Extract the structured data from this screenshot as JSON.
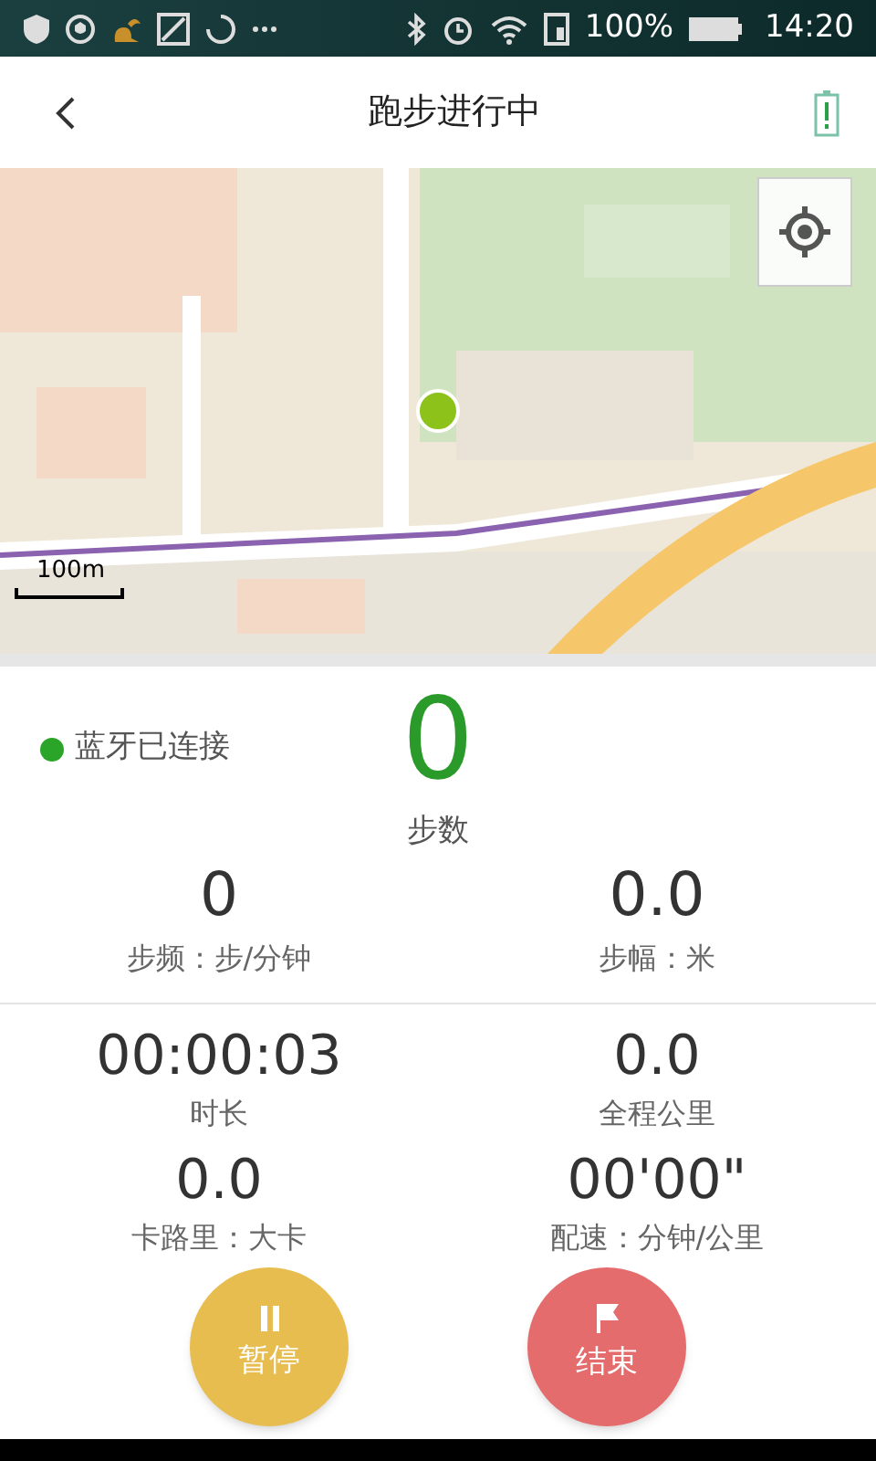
{
  "status_bar": {
    "battery_text": "100%",
    "time": "14:20"
  },
  "header": {
    "title": "跑步进行中"
  },
  "map": {
    "scale": "100m"
  },
  "bluetooth": {
    "label": "蓝牙已连接",
    "connected": true
  },
  "steps": {
    "value": "0",
    "label": "步数"
  },
  "cadence": [
    {
      "value": "0",
      "label": "步频：步/分钟"
    },
    {
      "value": "0.0",
      "label": "步幅：米"
    }
  ],
  "metrics": [
    {
      "value": "00:00:03",
      "label": "时长"
    },
    {
      "value": "0.0",
      "label": "全程公里"
    },
    {
      "value": "0.0",
      "label": "卡路里：大卡"
    },
    {
      "value": "00'00\"",
      "label": "配速：分钟/公里"
    }
  ],
  "buttons": [
    {
      "label": "暂停",
      "kind": "pause"
    },
    {
      "label": "结束",
      "kind": "stop"
    }
  ]
}
